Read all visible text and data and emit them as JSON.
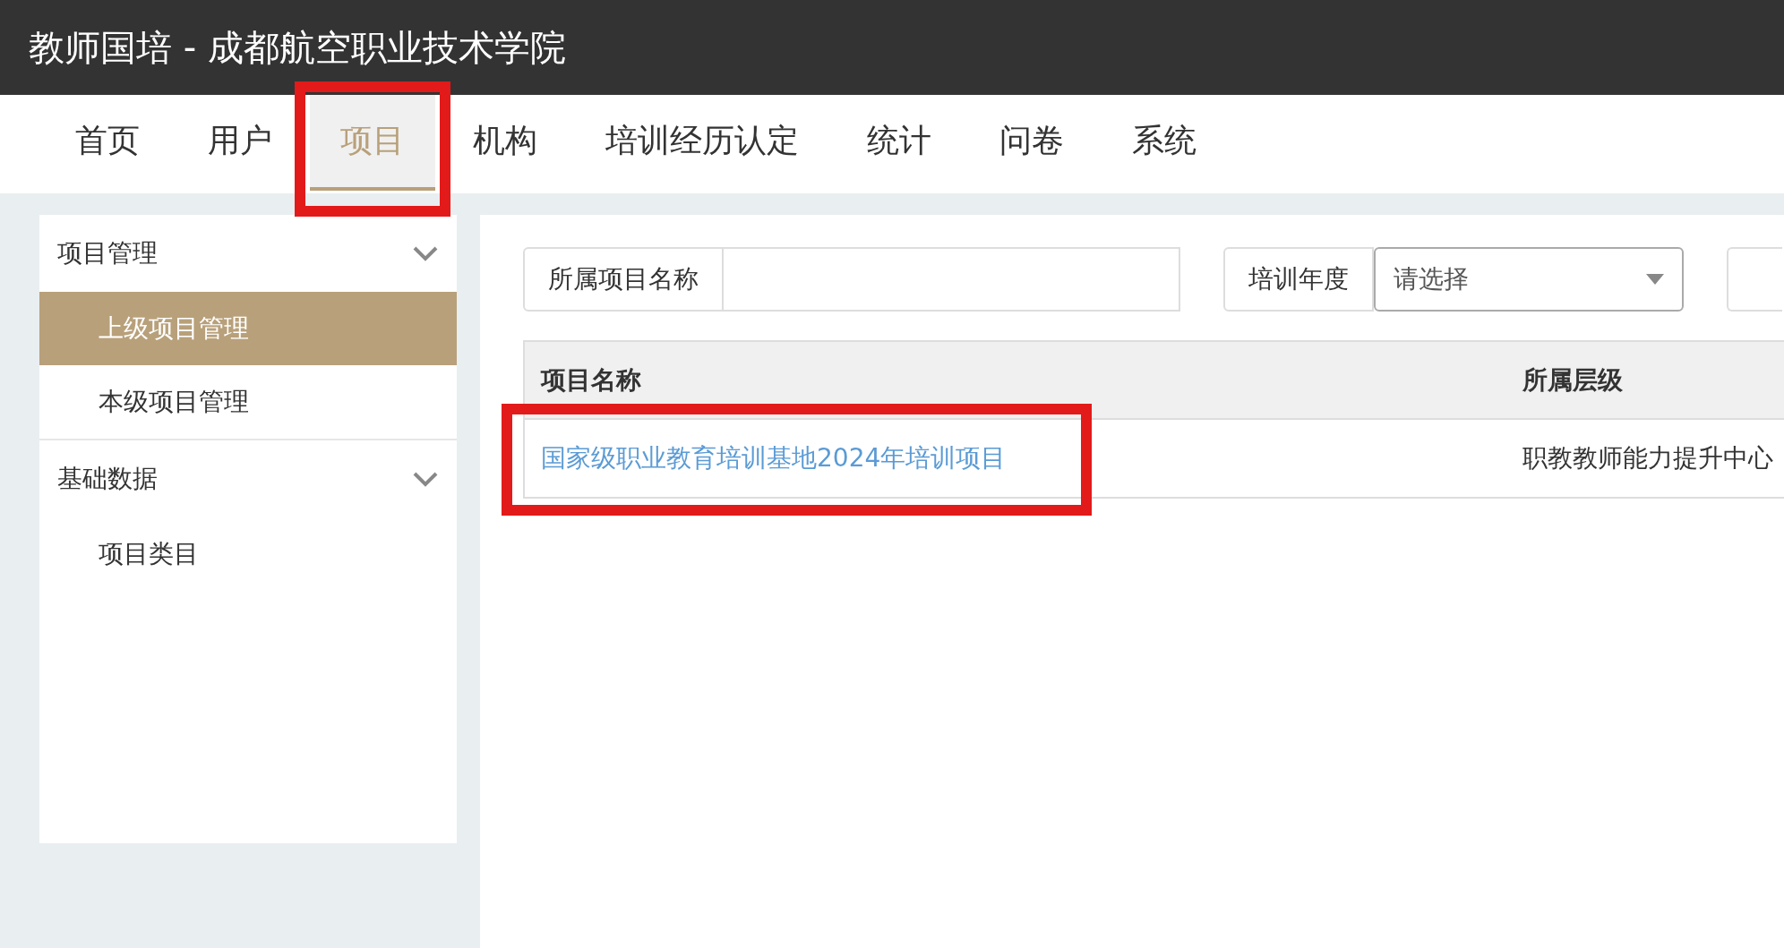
{
  "app_title": "教师国培 - 成都航空职业技术学院",
  "nav": [
    {
      "label": "首页",
      "selected": false,
      "highlighted": false
    },
    {
      "label": "用户",
      "selected": false,
      "highlighted": false
    },
    {
      "label": "项目",
      "selected": true,
      "highlighted": true
    },
    {
      "label": "机构",
      "selected": false,
      "highlighted": false
    },
    {
      "label": "培训经历认定",
      "selected": false,
      "highlighted": false
    },
    {
      "label": "统计",
      "selected": false,
      "highlighted": false
    },
    {
      "label": "问卷",
      "selected": false,
      "highlighted": false
    },
    {
      "label": "系统",
      "selected": false,
      "highlighted": false
    }
  ],
  "sidebar": [
    {
      "label": "项目管理",
      "expanded": true,
      "children": [
        {
          "label": "上级项目管理",
          "selected": true
        },
        {
          "label": "本级项目管理",
          "selected": false
        }
      ]
    },
    {
      "label": "基础数据",
      "expanded": true,
      "children": [
        {
          "label": "项目类目",
          "selected": false
        }
      ]
    }
  ],
  "filters": [
    {
      "kind": "text",
      "label": "所属项目名称"
    },
    {
      "kind": "select",
      "label": "培训年度",
      "placeholder": "请选择"
    }
  ],
  "table": {
    "columns": [
      "项目名称",
      "所属层级"
    ],
    "rows": [
      {
        "name": "国家级职业教育培训基地2024年培训项目",
        "level": "职教教师能力提升中心",
        "highlighted": true
      }
    ]
  }
}
